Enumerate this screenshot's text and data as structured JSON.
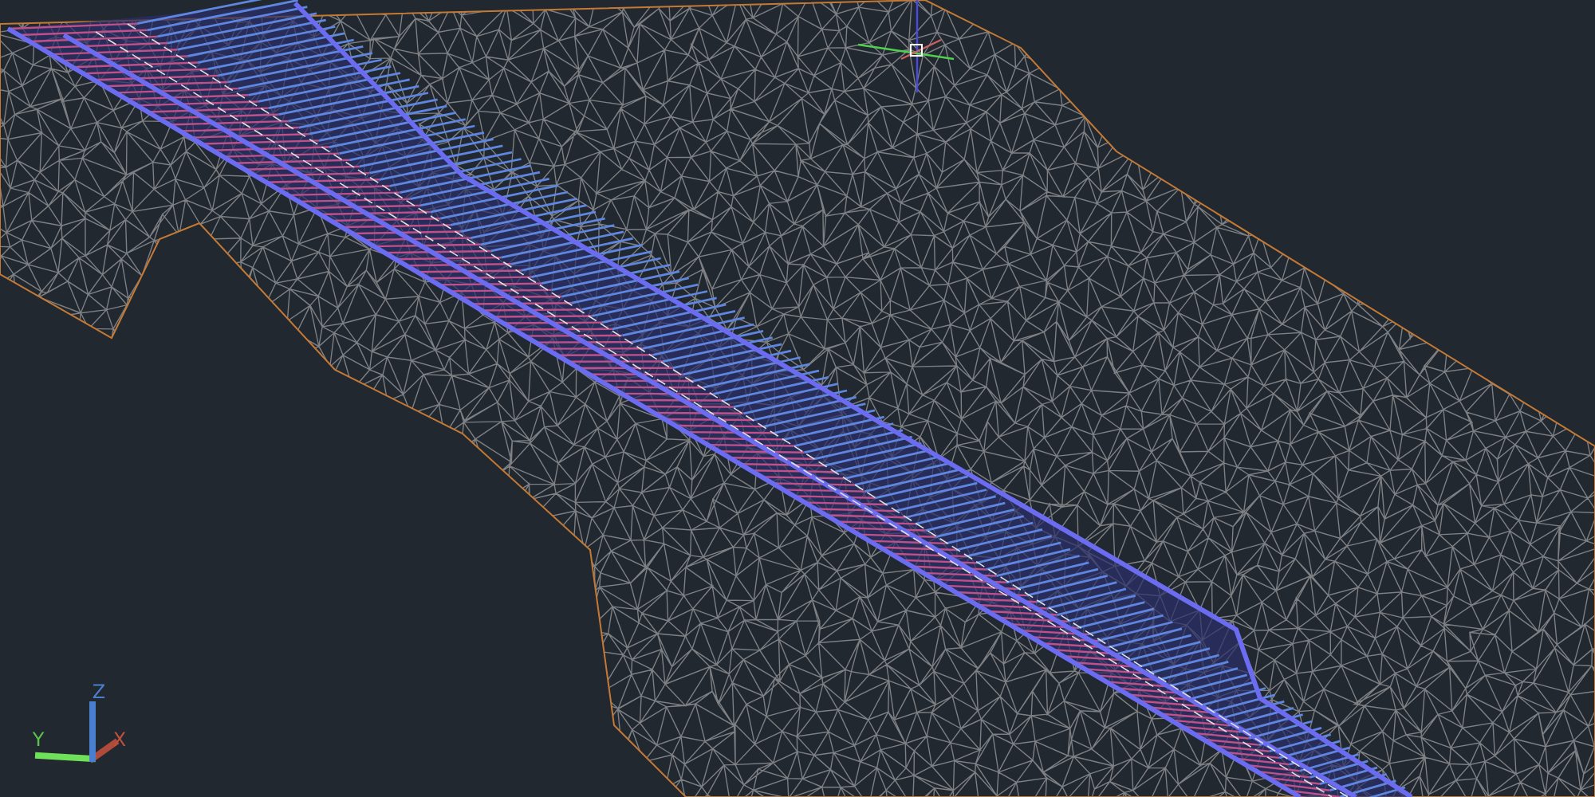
{
  "viewport": {
    "ucs_icon": {
      "axes": [
        {
          "kind": "x",
          "label": "X"
        },
        {
          "kind": "y",
          "label": "Y"
        },
        {
          "kind": "z",
          "label": "Z"
        }
      ]
    }
  }
}
